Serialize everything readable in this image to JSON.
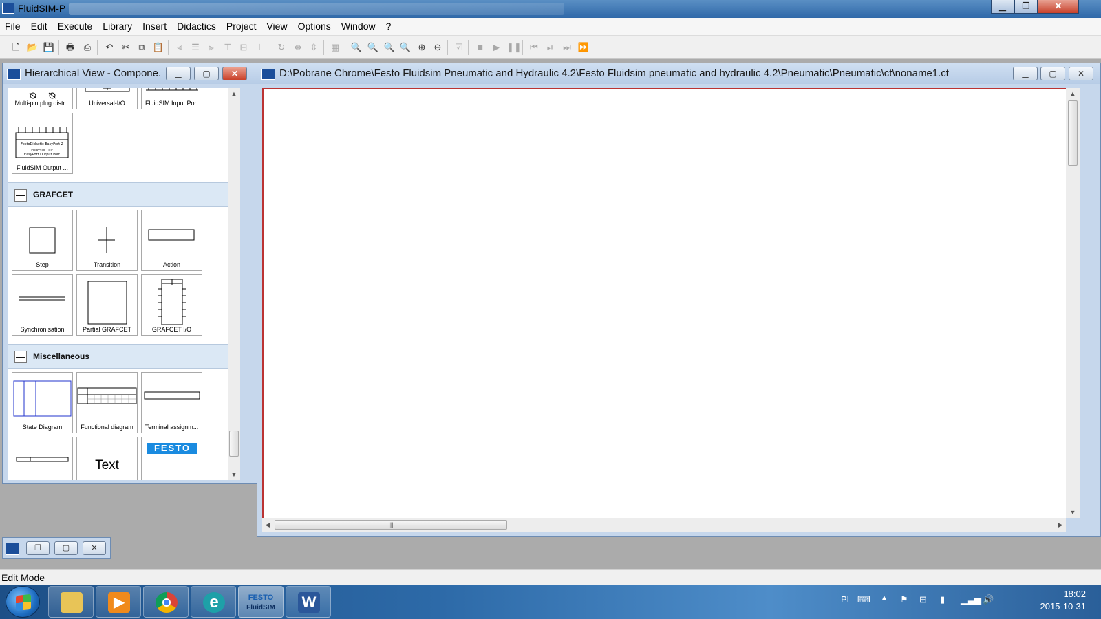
{
  "app": {
    "title": "FluidSIM-P"
  },
  "menu": [
    "File",
    "Edit",
    "Execute",
    "Library",
    "Insert",
    "Didactics",
    "Project",
    "View",
    "Options",
    "Window",
    "?"
  ],
  "library_window": {
    "title": "Hierarchical View - Compone...",
    "top_tiles": [
      "Multi-pin plug distr...",
      "Universal-I/O",
      "FluidSIM Input Port"
    ],
    "output_tile": "FluidSIM Output ...",
    "output_tile_art_text": [
      "FestoDidactic EasyPort 2",
      "FluidSIM Out",
      "EasyPort Output Port"
    ],
    "sections": [
      {
        "label": "GRAFCET",
        "toggle": "—",
        "tiles": [
          "Step",
          "Transition",
          "Action",
          "Synchronisation",
          "Partial GRAFCET",
          "GRAFCET I/O"
        ]
      },
      {
        "label": "Miscellaneous",
        "toggle": "—",
        "tiles": [
          "State Diagram",
          "Functional diagram",
          "Terminal assignm...",
          "",
          "",
          ""
        ]
      }
    ],
    "text_tile_caption": "Text",
    "festo_logo_text": "FESTO"
  },
  "circuit_window": {
    "title": "D:\\Pobrane Chrome\\Festo Fluidsim Pneumatic and Hydraulic 4.2\\Festo Fluidsim pneumatic and hydraulic 4.2\\Pneumatic\\Pneumatic\\ct\\noname1.ct"
  },
  "status": {
    "mode": "Edit Mode"
  },
  "taskbar": {
    "apps": [
      "file-explorer",
      "media-player",
      "chrome",
      "edge-e",
      "fluidsim",
      "word"
    ],
    "fluidsim_label_top": "FESTO",
    "fluidsim_label_bottom": "FluidSIM",
    "language": "PL",
    "time": "18:02",
    "date": "2015-10-31"
  },
  "colors": {
    "title_bar": "#2f68a8",
    "child_frame": "#c6d7ec",
    "canvas_border": "#b33333",
    "taskbar": "#2d6aa8",
    "festo_blue": "#1a8be0"
  }
}
